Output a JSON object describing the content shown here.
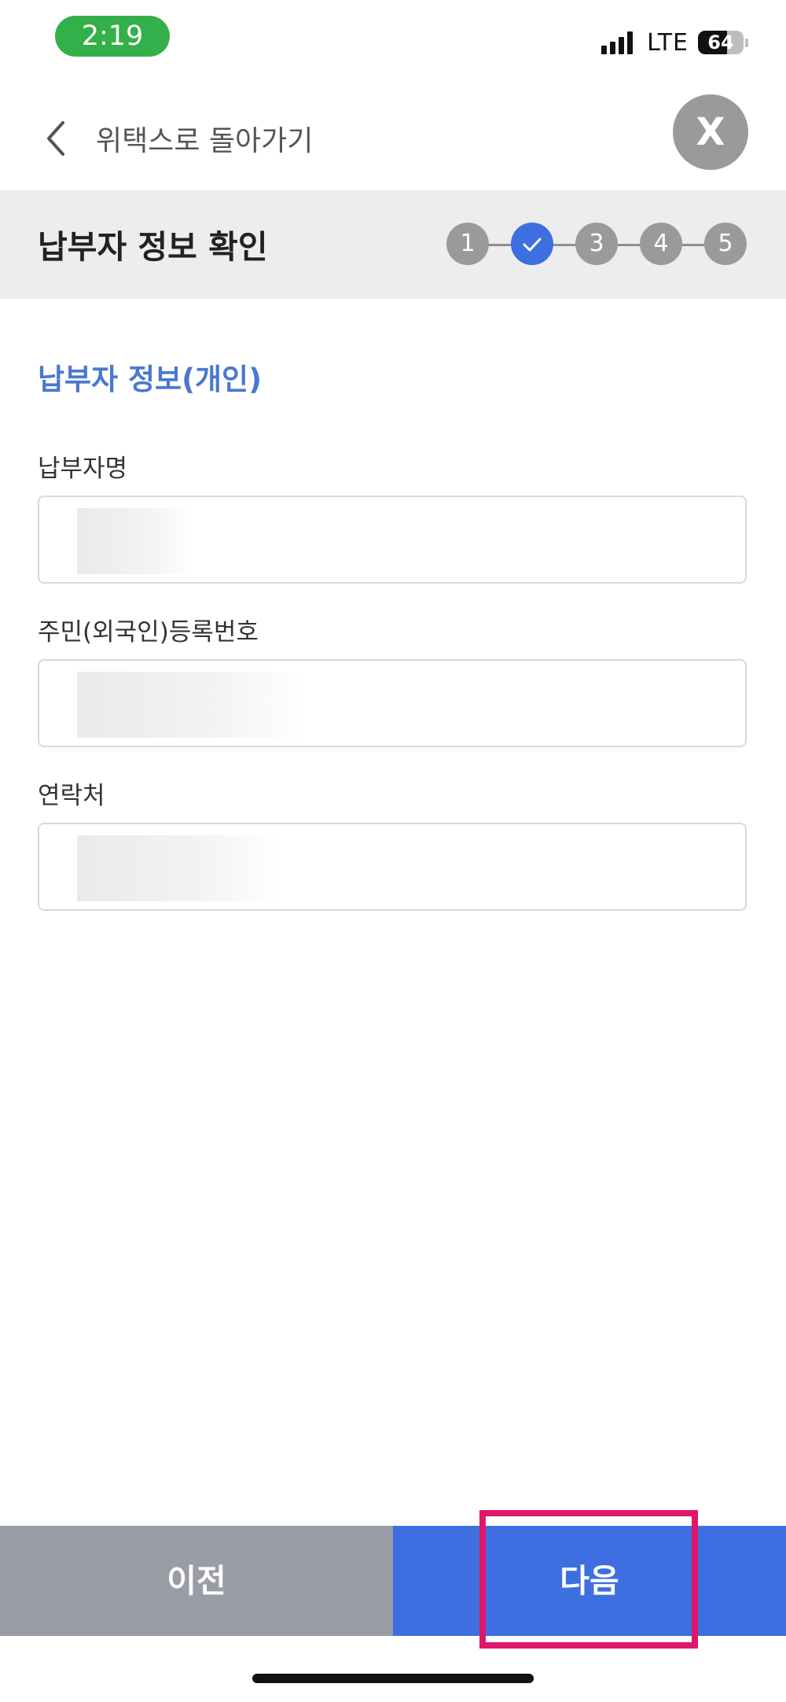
{
  "status_bar": {
    "time": "2:19",
    "network": "LTE",
    "battery": "64",
    "battery_level": 0.64
  },
  "nav": {
    "back_label": "위택스로 돌아가기",
    "close_label": "X"
  },
  "step_header": {
    "title": "납부자 정보 확인",
    "steps": [
      {
        "label": "1",
        "state": "default"
      },
      {
        "label": "",
        "state": "done",
        "icon": "check-icon"
      },
      {
        "label": "3",
        "state": "default"
      },
      {
        "label": "4",
        "state": "default"
      },
      {
        "label": "5",
        "state": "default"
      }
    ]
  },
  "form": {
    "section_title": "납부자 정보(개인)",
    "fields": [
      {
        "label": "납부자명",
        "value": ""
      },
      {
        "label": "주민(외국인)등록번호",
        "value": ""
      },
      {
        "label": "연락처",
        "value": ""
      }
    ]
  },
  "buttons": {
    "prev": "이전",
    "next": "다음"
  },
  "colors": {
    "accent": "#3d6fe0",
    "section_title": "#4a78cf",
    "highlight": "#e0166b",
    "time_pill": "#34b04a"
  }
}
